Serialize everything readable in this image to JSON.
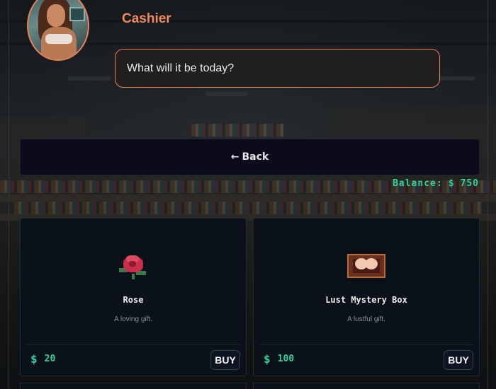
{
  "header": {
    "speaker": "Cashier",
    "dialogue": "What will it be today?"
  },
  "nav": {
    "back_arrow": "←",
    "back_label": "Back"
  },
  "balance": {
    "label": "Balance:",
    "currency": "$",
    "value": "750"
  },
  "items": [
    {
      "name": "Rose",
      "description": "A loving gift.",
      "currency": "$",
      "price": "20",
      "buy_label": "BUY",
      "icon": "rose-icon"
    },
    {
      "name": "Lust Mystery Box",
      "description": "A lustful gift.",
      "currency": "$",
      "price": "100",
      "buy_label": "BUY",
      "icon": "mystery-box-icon"
    }
  ],
  "colors": {
    "accent": "#f08a5d",
    "price": "#2fd39a",
    "card_bg": "#0a1118",
    "button_bg": "#0c0b1c"
  }
}
